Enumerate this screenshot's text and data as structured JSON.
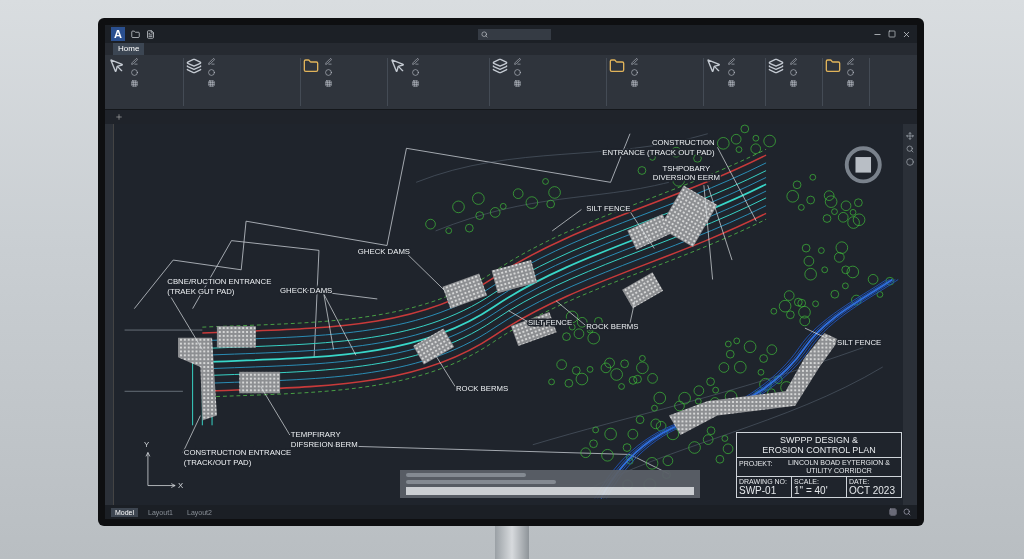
{
  "app": {
    "logo": "A"
  },
  "ribbon": {
    "active_tab": {
      "label": "Home",
      "selected": true
    }
  },
  "drawing": {
    "axis_x": "X",
    "axis_y": "Y",
    "annotations": [
      {
        "lines": [
          "CONSTRUCTION",
          "ENTRANCE (TRACK OUT PAD)"
        ]
      },
      {
        "lines": [
          "TSHPOBARY",
          "DIVERSION EERM"
        ]
      },
      {
        "lines": [
          "SILT FENCE"
        ]
      },
      {
        "lines": [
          "GHECK DAMS"
        ]
      },
      {
        "lines": [
          "CBNE/RUCTION ENTRANCE",
          "(TRAEK GUT PAD)"
        ]
      },
      {
        "lines": [
          "GHECK DAMS"
        ]
      },
      {
        "lines": [
          "SILT FENCE"
        ]
      },
      {
        "lines": [
          "ROCK BERMS"
        ]
      },
      {
        "lines": [
          "ROCK BERMS"
        ]
      },
      {
        "lines": [
          "SILT FENCE"
        ]
      },
      {
        "lines": [
          "TEMPFIRARY",
          "DIFSREION BERM"
        ]
      },
      {
        "lines": [
          "CONSTRUCTION ENTRANCE",
          "(TRACK/OUT PAD)"
        ]
      }
    ],
    "title_block": {
      "title": [
        "SWPPP DESIGN &",
        "EROSION CONTROL PLAN"
      ],
      "project_label": "PROJEKT:",
      "project": [
        "LINCOLN BOAD EYTERGION &",
        "UTILITY CORRIDCR"
      ],
      "fields": [
        {
          "label": "DRAWING NO:",
          "value": "SWP-01"
        },
        {
          "label": "SCALE:",
          "value": "1\" = 40'"
        },
        {
          "label": "DATE:",
          "value": "OCT 2023"
        }
      ]
    }
  },
  "layout_tabs": [
    {
      "label": "Model",
      "selected": true
    },
    {
      "label": "Layout1",
      "selected": false
    },
    {
      "label": "Layout2",
      "selected": false
    }
  ]
}
